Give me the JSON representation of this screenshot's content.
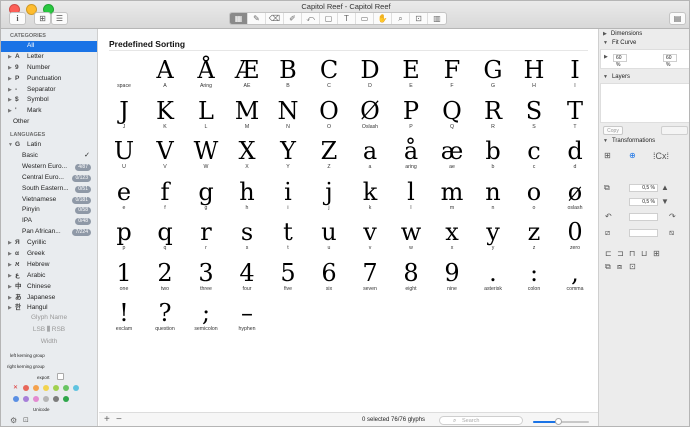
{
  "window": {
    "title": "Capitol Reef - Capitol Reef"
  },
  "toolbar": {
    "info_label": "i",
    "tools": [
      "▦",
      "✎",
      "⌫",
      "✐",
      "⤺",
      "▢",
      "T",
      "▭",
      "✋",
      "⌕",
      "⊡",
      "▥"
    ]
  },
  "sidebar": {
    "categories_header": "CATEGORIES",
    "categories": [
      {
        "label": "All",
        "icon": "",
        "selected": true,
        "expandable": false
      },
      {
        "label": "Letter",
        "icon": "A",
        "expandable": true
      },
      {
        "label": "Number",
        "icon": "9",
        "expandable": true
      },
      {
        "label": "Punctuation",
        "icon": "P",
        "expandable": true
      },
      {
        "label": "Separator",
        "icon": "-",
        "expandable": true
      },
      {
        "label": "Symbol",
        "icon": "$",
        "expandable": true
      },
      {
        "label": "Mark",
        "icon": "'",
        "expandable": true
      },
      {
        "label": "Other",
        "icon": "",
        "expandable": false
      }
    ],
    "languages_header": "LANGUAGES",
    "languages_top": {
      "label": "Latin",
      "icon": "G"
    },
    "latin_subs": [
      {
        "label": "Basic",
        "check": "✓",
        "badge": ""
      },
      {
        "label": "Western Euro...",
        "check": "",
        "badge": "4/87"
      },
      {
        "label": "Central Euro...",
        "check": "",
        "badge": "0/123"
      },
      {
        "label": "South Eastern...",
        "check": "",
        "badge": "0/51"
      },
      {
        "label": "Vietnamese",
        "check": "",
        "badge": "0/181"
      },
      {
        "label": "Pinyin",
        "check": "",
        "badge": "0/58"
      },
      {
        "label": "IPA",
        "check": "",
        "badge": "0/48"
      },
      {
        "label": "Pan African...",
        "check": "",
        "badge": "7/224"
      }
    ],
    "other_languages": [
      {
        "label": "Cyrillic",
        "icon": "Я"
      },
      {
        "label": "Greek",
        "icon": "α"
      },
      {
        "label": "Hebrew",
        "icon": "א"
      },
      {
        "label": "Arabic",
        "icon": "ع"
      },
      {
        "label": "Chinese",
        "icon": "中"
      },
      {
        "label": "Japanese",
        "icon": "あ"
      },
      {
        "label": "Hangul",
        "icon": "한"
      }
    ],
    "glyph_info": {
      "glyph_name": "Glyph Name",
      "lsb": "LSB",
      "rsb": "RSB",
      "width": "Width",
      "left_kerning": "left kerning group",
      "right_kerning": "right kerning group",
      "export": "export",
      "unicode": "Unicode"
    },
    "swatch_colors": [
      "#e8675a",
      "#f4a14d",
      "#f2d34e",
      "#a1d04e",
      "#67c462",
      "#5fc3e0",
      "#5a8fe4",
      "#a77fd9",
      "#e38ad1",
      "#b5b5b5",
      "#7c7c7c",
      "#2ea64a"
    ]
  },
  "main": {
    "title": "Predefined Sorting",
    "glyphs": [
      {
        "char": "",
        "name": "space"
      },
      {
        "char": "A",
        "name": "A"
      },
      {
        "char": "Å",
        "name": "Aring"
      },
      {
        "char": "Æ",
        "name": "AE"
      },
      {
        "char": "B",
        "name": "B"
      },
      {
        "char": "C",
        "name": "C"
      },
      {
        "char": "D",
        "name": "D"
      },
      {
        "char": "E",
        "name": "E"
      },
      {
        "char": "F",
        "name": "F"
      },
      {
        "char": "G",
        "name": "G"
      },
      {
        "char": "H",
        "name": "H"
      },
      {
        "char": "I",
        "name": "I"
      },
      {
        "char": "J",
        "name": "J"
      },
      {
        "char": "K",
        "name": "K"
      },
      {
        "char": "L",
        "name": "L"
      },
      {
        "char": "M",
        "name": "M"
      },
      {
        "char": "N",
        "name": "N"
      },
      {
        "char": "O",
        "name": "O"
      },
      {
        "char": "Ø",
        "name": "Oslash"
      },
      {
        "char": "P",
        "name": "P"
      },
      {
        "char": "Q",
        "name": "Q"
      },
      {
        "char": "R",
        "name": "R"
      },
      {
        "char": "S",
        "name": "S"
      },
      {
        "char": "T",
        "name": "T"
      },
      {
        "char": "U",
        "name": "U"
      },
      {
        "char": "V",
        "name": "V"
      },
      {
        "char": "W",
        "name": "W"
      },
      {
        "char": "X",
        "name": "X"
      },
      {
        "char": "Y",
        "name": "Y"
      },
      {
        "char": "Z",
        "name": "Z"
      },
      {
        "char": "a",
        "name": "a"
      },
      {
        "char": "å",
        "name": "aring"
      },
      {
        "char": "æ",
        "name": "ae"
      },
      {
        "char": "b",
        "name": "b"
      },
      {
        "char": "c",
        "name": "c"
      },
      {
        "char": "d",
        "name": "d"
      },
      {
        "char": "e",
        "name": "e"
      },
      {
        "char": "f",
        "name": "f"
      },
      {
        "char": "g",
        "name": "g"
      },
      {
        "char": "h",
        "name": "h"
      },
      {
        "char": "i",
        "name": "i"
      },
      {
        "char": "j",
        "name": "j"
      },
      {
        "char": "k",
        "name": "k"
      },
      {
        "char": "l",
        "name": "l"
      },
      {
        "char": "m",
        "name": "m"
      },
      {
        "char": "n",
        "name": "n"
      },
      {
        "char": "o",
        "name": "o"
      },
      {
        "char": "ø",
        "name": "oslash"
      },
      {
        "char": "p",
        "name": "p"
      },
      {
        "char": "q",
        "name": "q"
      },
      {
        "char": "r",
        "name": "r"
      },
      {
        "char": "s",
        "name": "s"
      },
      {
        "char": "t",
        "name": "t"
      },
      {
        "char": "u",
        "name": "u"
      },
      {
        "char": "v",
        "name": "v"
      },
      {
        "char": "w",
        "name": "w"
      },
      {
        "char": "x",
        "name": "x"
      },
      {
        "char": "y",
        "name": "y"
      },
      {
        "char": "z",
        "name": "z"
      },
      {
        "char": "0",
        "name": "zero"
      },
      {
        "char": "1",
        "name": "one"
      },
      {
        "char": "2",
        "name": "two"
      },
      {
        "char": "3",
        "name": "three"
      },
      {
        "char": "4",
        "name": "four"
      },
      {
        "char": "5",
        "name": "five"
      },
      {
        "char": "6",
        "name": "six"
      },
      {
        "char": "7",
        "name": "seven"
      },
      {
        "char": "8",
        "name": "eight"
      },
      {
        "char": "9",
        "name": "nine"
      },
      {
        "char": ".",
        "name": "asterisk"
      },
      {
        "char": ":",
        "name": "colon"
      },
      {
        "char": ",",
        "name": "comma"
      },
      {
        "char": "!",
        "name": "exclam"
      },
      {
        "char": "?",
        "name": "question"
      },
      {
        "char": ";",
        "name": "semicolon"
      },
      {
        "char": "–",
        "name": "hyphen"
      }
    ],
    "status": "0 selected 76/76 glyphs",
    "search_placeholder": "Search",
    "add_label": "+",
    "remove_label": "−",
    "zoom_level": 0.45
  },
  "rpanel": {
    "dimensions": "Dimensions",
    "fit_curve": "Fit Curve",
    "fit_val_1": "60 %",
    "fit_val_2": "60 %",
    "layers": "Layers",
    "copy": "Copy",
    "none": "None",
    "transformations": "Transformations",
    "scale_1": "0,5 %",
    "scale_2": "0,5 %"
  }
}
